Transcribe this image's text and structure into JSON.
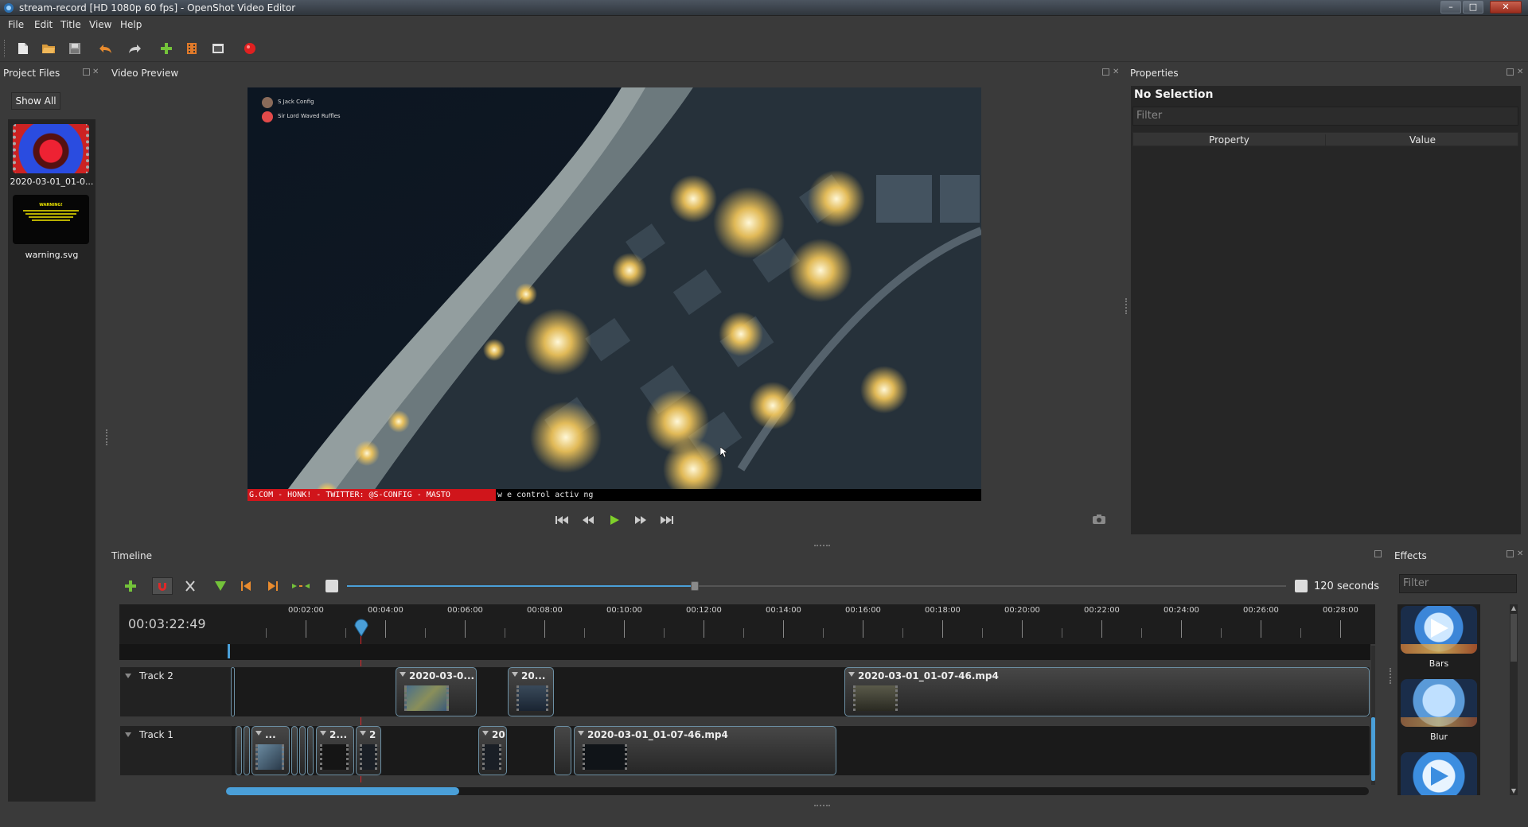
{
  "window": {
    "title": "stream-record [HD 1080p 60 fps] - OpenShot Video Editor",
    "minimize": "–",
    "maximize": "□",
    "close": "✕"
  },
  "menu": [
    "File",
    "Edit",
    "Title",
    "View",
    "Help"
  ],
  "toolbar": {
    "icons": [
      "new-project-icon",
      "open-project-icon",
      "save-project-icon",
      "undo-icon",
      "redo-icon",
      "import-files-icon",
      "profile-icon",
      "fullscreen-icon",
      "export-video-icon"
    ]
  },
  "project_files": {
    "title": "Project Files",
    "show_all": "Show All",
    "files": [
      {
        "name": "2020-03-01_01-0..."
      },
      {
        "name": "warning.svg"
      }
    ],
    "warning_thumb_heading": "WARNING!"
  },
  "video_preview": {
    "title": "Video Preview",
    "overlay_users": [
      "S Jack Config",
      "Sir Lord Waved Ruffles"
    ],
    "ticker_red": "G.COM - HONK! - TWITTER: @S-CONFIG - MASTO",
    "ticker_white": "w   e control activ         ng"
  },
  "properties": {
    "title": "Properties",
    "selection": "No Selection",
    "filter_placeholder": "Filter",
    "columns": [
      "Property",
      "Value"
    ]
  },
  "timeline": {
    "title": "Timeline",
    "time": "00:03:22:49",
    "zoom_label": "120 seconds",
    "zoom_fraction": 0.37,
    "ticks": [
      "00:02:00",
      "00:04:00",
      "00:06:00",
      "00:08:00",
      "00:10:00",
      "00:12:00",
      "00:14:00",
      "00:16:00",
      "00:18:00",
      "00:20:00",
      "00:22:00",
      "00:24:00",
      "00:26:00",
      "00:28:00"
    ],
    "tracks": [
      {
        "name": "Track 2",
        "clips": [
          {
            "title": "2020-03-0..."
          },
          {
            "title": "20..."
          },
          {
            "title": "2020-03-01_01-07-46.mp4"
          }
        ]
      },
      {
        "name": "Track 1",
        "clips": [
          {
            "title": "..."
          },
          {
            "title": "2..."
          },
          {
            "title": "2"
          },
          {
            "title": "20"
          },
          {
            "title": "2020-03-01_01-07-46.mp4"
          }
        ]
      }
    ]
  },
  "effects": {
    "title": "Effects",
    "filter_placeholder": "Filter",
    "items": [
      "Bars",
      "Blur"
    ]
  },
  "colors": {
    "accent_blue": "#4a9fd8",
    "playhead_red": "#e0262a",
    "ticker_red": "#d0151b",
    "record_red": "#e02020",
    "add_green": "#74c33a"
  }
}
